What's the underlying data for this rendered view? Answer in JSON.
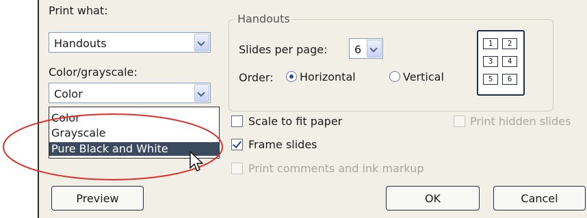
{
  "print_what": {
    "label": "Print what:",
    "value": "Handouts"
  },
  "color_grayscale": {
    "label": "Color/grayscale:",
    "value": "Color",
    "options": [
      "Color",
      "Grayscale",
      "Pure Black and White"
    ],
    "highlighted": "Pure Black and White"
  },
  "handouts": {
    "title": "Handouts",
    "slides_per_page_label": "Slides per page:",
    "slides_per_page_value": "6",
    "order_label": "Order:",
    "order_horizontal": "Horizontal",
    "order_vertical": "Vertical",
    "order_selected": "Horizontal",
    "preview_numbers": [
      "1",
      "2",
      "3",
      "4",
      "5",
      "6"
    ]
  },
  "options": {
    "scale_to_fit": {
      "label": "Scale to fit paper",
      "checked": false
    },
    "print_hidden": {
      "label": "Print hidden slides",
      "checked": false,
      "enabled": false
    },
    "frame_slides": {
      "label": "Frame slides",
      "checked": true
    },
    "print_comments": {
      "label": "Print comments and ink markup",
      "checked": false,
      "enabled": false
    }
  },
  "buttons": {
    "preview": "Preview",
    "ok": "OK",
    "cancel": "Cancel"
  },
  "colors": {
    "highlight": "#3b4a5e",
    "annotation_circle": "#d9302a",
    "dialog_bg": "#f1efe6"
  }
}
